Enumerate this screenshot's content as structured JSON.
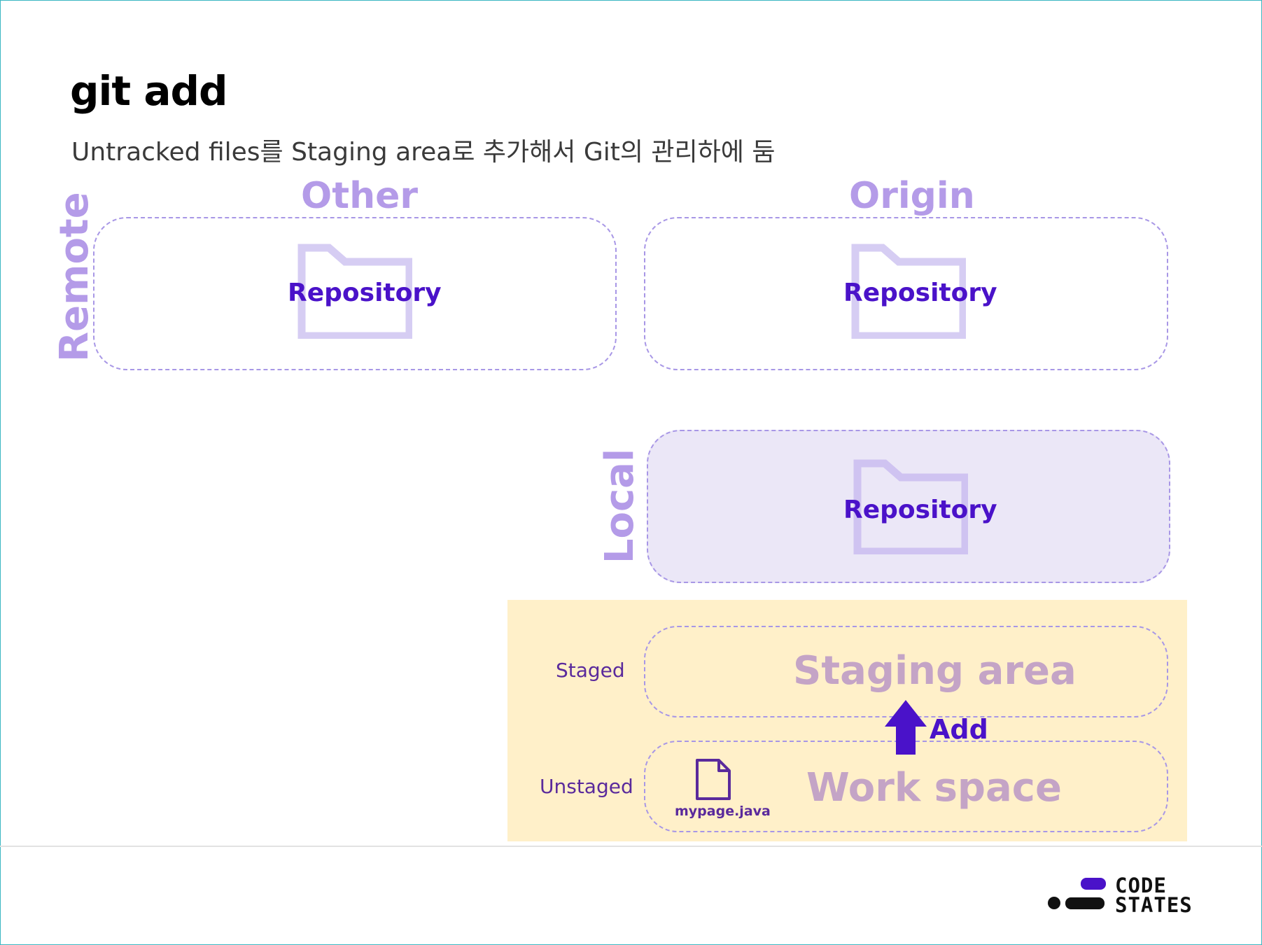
{
  "slide": {
    "title": "git add",
    "subtitle": "Untracked files를 Staging area로 추가해서 Git의 관리하에 둠"
  },
  "remote": {
    "label": "Remote",
    "other": {
      "name": "Other",
      "repo_label": "Repository"
    },
    "origin": {
      "name": "Origin",
      "repo_label": "Repository"
    }
  },
  "local": {
    "label": "Local",
    "repo_label": "Repository"
  },
  "workflow": {
    "staged_label": "Staged",
    "unstaged_label": "Unstaged",
    "staging_area_label": "Staging area",
    "work_space_label": "Work space",
    "add_label": "Add",
    "file_name": "mypage.java"
  },
  "logo": {
    "line1": "CODE",
    "line2": "STATES"
  },
  "colors": {
    "accent": "#4a12c9",
    "lavender": "#b49be8",
    "folder": "#d6cdf3",
    "local_fill": "#ebe7f7",
    "panel": "#fff0c9",
    "area_text": "#c4a4c6"
  }
}
